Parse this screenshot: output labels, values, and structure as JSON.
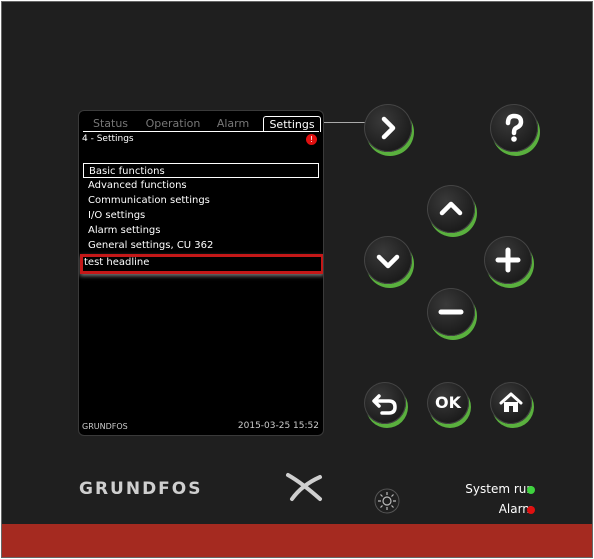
{
  "tabs": [
    {
      "label": "Status"
    },
    {
      "label": "Operation"
    },
    {
      "label": "Alarm"
    },
    {
      "label": "Settings"
    }
  ],
  "breadcrumb": "4 - Settings",
  "badge": "!",
  "menu": [
    {
      "label": "Basic functions"
    },
    {
      "label": "Advanced functions"
    },
    {
      "label": "Communication settings"
    },
    {
      "label": "I/O settings"
    },
    {
      "label": "Alarm settings"
    },
    {
      "label": "General settings, CU 362"
    }
  ],
  "headline": "test headline",
  "footer": {
    "brand": "GRUNDFOS",
    "datetime": "2015-03-25  15:52"
  },
  "buttons": {
    "ok": "OK"
  },
  "logo": {
    "text": "GRUNDFOS"
  },
  "status": {
    "system_run": "System run",
    "alarm": "Alarm"
  },
  "colors": {
    "accent": "#5ab03e",
    "brand_red": "#a52a20",
    "alarm_led": "#e01010",
    "run_led": "#3ed23e"
  }
}
